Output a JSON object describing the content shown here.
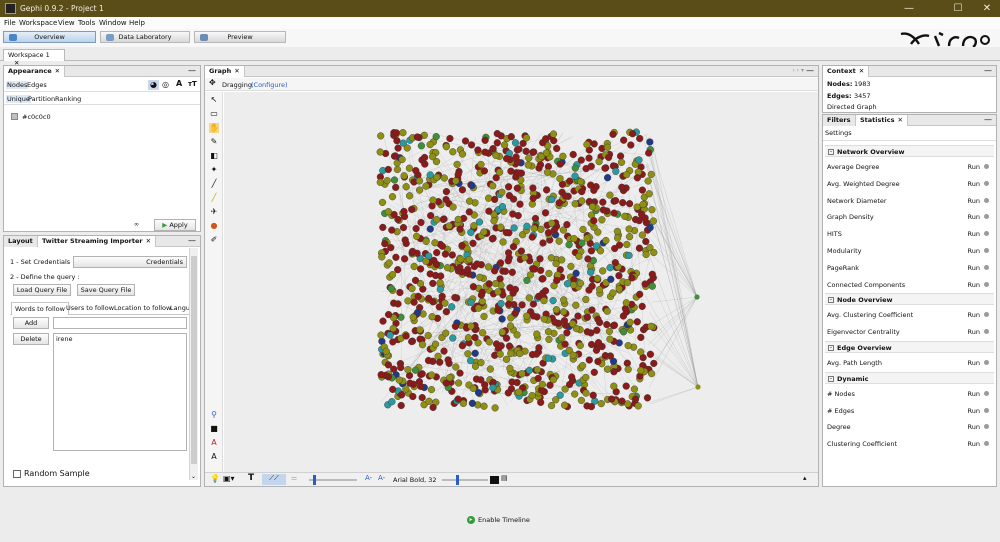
{
  "window": {
    "title": "Gephi 0.9.2 - Project 1",
    "min": "—",
    "max": "☐",
    "close": "✕"
  },
  "menu": [
    "File",
    "Workspace",
    "View",
    "Tools",
    "Window",
    "Help"
  ],
  "modes": {
    "overview": "Overview",
    "data_lab": "Data Laboratory",
    "preview": "Preview"
  },
  "workspace_tab": {
    "label": "Workspace 1",
    "close": "✕"
  },
  "appearance": {
    "tab": "Appearance",
    "target_tabs": [
      "Nodes",
      "Edges"
    ],
    "mode_tabs": [
      "Unique",
      "Partition",
      "Ranking"
    ],
    "color_value": "#c0c0c0",
    "apply": "Apply"
  },
  "twitter": {
    "tabs": [
      "Layout",
      "Twitter Streaming Importer"
    ],
    "set_credentials": "1 - Set Credentials :",
    "credentials_btn": "Credentials",
    "define_query": "2 - Define the query :",
    "load_query": "Load Query File",
    "save_query": "Save Query File",
    "query_tabs": [
      "Words to follow",
      "Users to follow",
      "Location to follow",
      "Langu"
    ],
    "add": "Add",
    "delete": "Delete",
    "words": [
      "irene"
    ],
    "random_sample": "Random Sample"
  },
  "graph": {
    "tab": "Graph",
    "dragging": "Dragging",
    "configure": "(Configure)",
    "font_label": "Arial Bold, 32",
    "node_colors": [
      "#8b1a1a",
      "#8f8f14",
      "#2b9aa0",
      "#1f3a8a",
      "#3f8f3a"
    ]
  },
  "context": {
    "tab": "Context",
    "nodes_label": "Nodes:",
    "nodes": "1983",
    "edges_label": "Edges:",
    "edges": "3457",
    "type": "Directed Graph"
  },
  "statistics": {
    "tabs": [
      "Filters",
      "Statistics"
    ],
    "settings": "Settings",
    "run": "Run",
    "sections": [
      {
        "title": "Network Overview",
        "items": [
          "Average Degree",
          "Avg. Weighted Degree",
          "Network Diameter",
          "Graph Density",
          "HITS",
          "Modularity",
          "PageRank",
          "Connected Components"
        ]
      },
      {
        "title": "Node Overview",
        "items": [
          "Avg. Clustering Coefficient",
          "Eigenvector Centrality"
        ]
      },
      {
        "title": "Edge Overview",
        "items": [
          "Avg. Path Length"
        ]
      },
      {
        "title": "Dynamic",
        "items": [
          "# Nodes",
          "# Edges",
          "Degree",
          "Clustering Coefficient"
        ]
      }
    ]
  },
  "timeline": {
    "label": "Enable Timeline"
  }
}
